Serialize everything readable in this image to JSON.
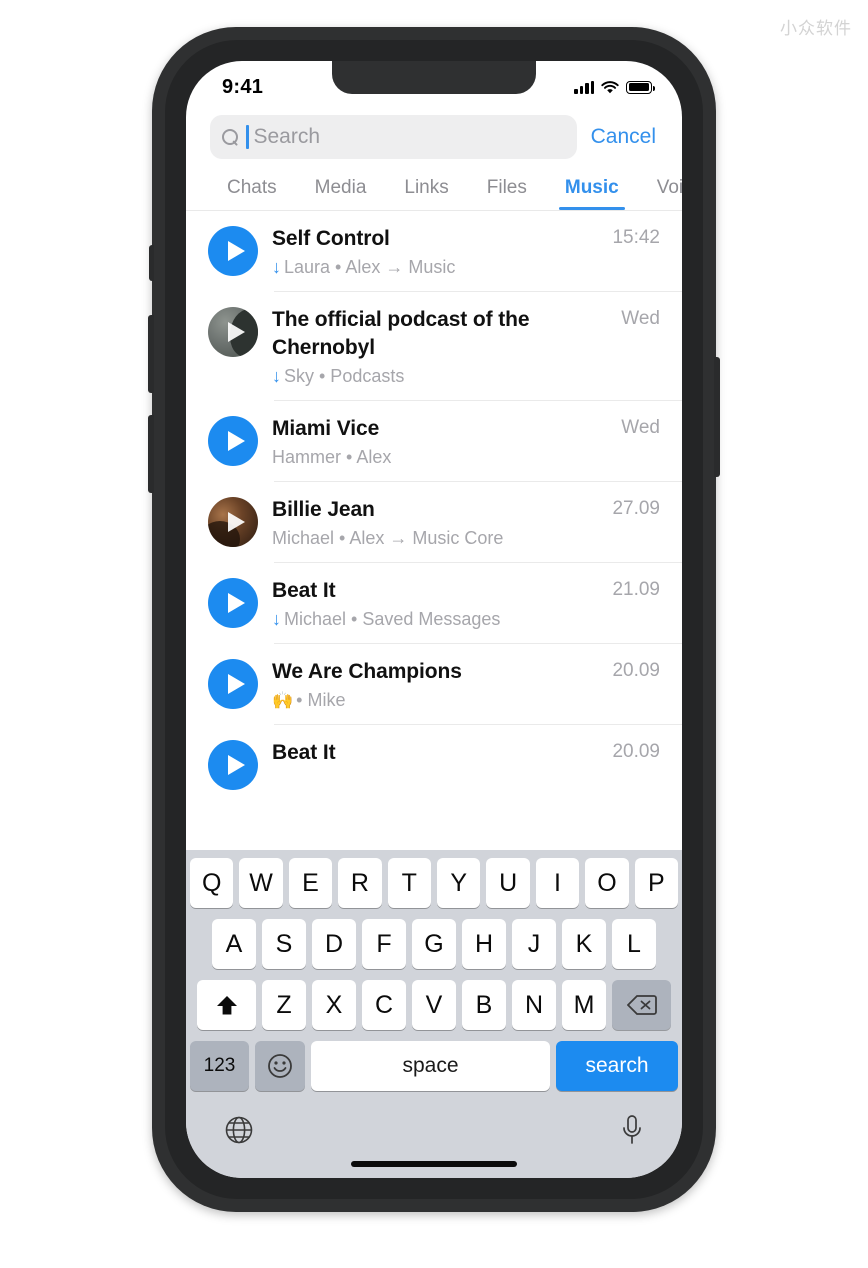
{
  "watermark": "小众软件",
  "status_bar": {
    "time": "9:41",
    "signal_icon": "cellular-signal-icon",
    "wifi_icon": "wifi-icon",
    "battery_icon": "battery-full-icon"
  },
  "search": {
    "placeholder": "Search",
    "value": "",
    "cancel_label": "Cancel",
    "icon": "search-icon"
  },
  "tabs": [
    {
      "label": "Chats",
      "active": false
    },
    {
      "label": "Media",
      "active": false
    },
    {
      "label": "Links",
      "active": false
    },
    {
      "label": "Files",
      "active": false
    },
    {
      "label": "Music",
      "active": true
    },
    {
      "label": "Voi",
      "active": false
    }
  ],
  "list": [
    {
      "title": "Self Control",
      "downloaded": true,
      "emoji": "",
      "subtitle": "Laura • Alex → Music",
      "time": "15:42",
      "avatar": "blue-play-button"
    },
    {
      "title": "The official podcast of the Chernobyl",
      "downloaded": true,
      "emoji": "",
      "subtitle": "Sky • Podcasts",
      "time": "Wed",
      "avatar": "grayscale-photo-thumbnail"
    },
    {
      "title": "Miami Vice",
      "downloaded": false,
      "emoji": "",
      "subtitle": "Hammer • Alex",
      "time": "Wed",
      "avatar": "blue-play-button"
    },
    {
      "title": "Billie Jean",
      "downloaded": false,
      "emoji": "",
      "subtitle": "Michael • Alex → Music Core",
      "time": "27.09",
      "avatar": "album-art-thumbnail"
    },
    {
      "title": "Beat It",
      "downloaded": true,
      "emoji": "",
      "subtitle": "Michael • Saved Messages",
      "time": "21.09",
      "avatar": "blue-play-button"
    },
    {
      "title": "We Are Champions",
      "downloaded": false,
      "emoji": "🙌",
      "subtitle": "• Mike",
      "time": "20.09",
      "avatar": "blue-play-button"
    },
    {
      "title": "Beat It",
      "downloaded": false,
      "emoji": "",
      "subtitle": "",
      "time": "20.09",
      "avatar": "blue-play-button"
    }
  ],
  "keyboard": {
    "row1": [
      "Q",
      "W",
      "E",
      "R",
      "T",
      "Y",
      "U",
      "I",
      "O",
      "P"
    ],
    "row2": [
      "A",
      "S",
      "D",
      "F",
      "G",
      "H",
      "J",
      "K",
      "L"
    ],
    "row3": [
      "Z",
      "X",
      "C",
      "V",
      "B",
      "N",
      "M"
    ],
    "shift_icon": "shift-arrow-up-icon",
    "backspace_icon": "backspace-delete-icon",
    "numbers_label": "123",
    "emoji_icon": "smiley-face-icon",
    "space_label": "space",
    "search_label": "search",
    "globe_icon": "globe-language-icon",
    "mic_icon": "microphone-dictation-icon"
  },
  "colors": {
    "accent": "#3390ec",
    "play_blue": "#1c8bf0",
    "key_gray": "#adb3bd",
    "keyboard_bg": "#d1d4da",
    "subtitle_gray": "#a6a6ab",
    "frame": "#2f3031"
  }
}
